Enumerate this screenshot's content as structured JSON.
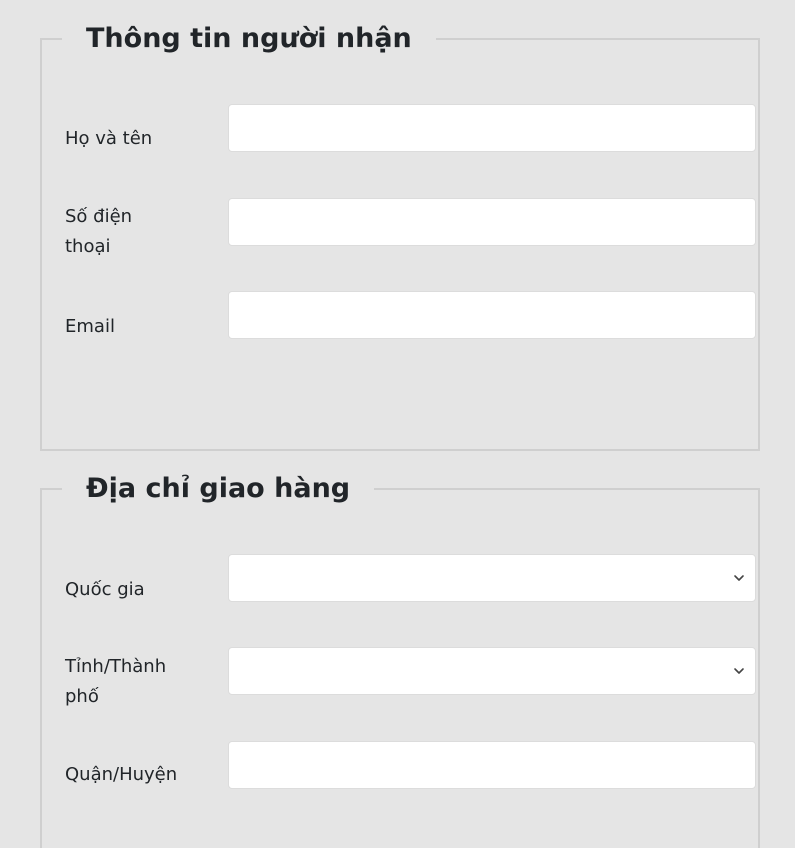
{
  "recipient": {
    "legend": "Thông tin người nhận",
    "fields": [
      {
        "label": "Họ và tên",
        "value": "",
        "placeholder": ""
      },
      {
        "label": "Số điện thoại",
        "value": "",
        "placeholder": ""
      },
      {
        "label": "Email",
        "value": "",
        "placeholder": ""
      }
    ]
  },
  "shipping": {
    "legend": "Địa chỉ giao hàng",
    "country": {
      "label": "Quốc gia",
      "selected": ""
    },
    "province": {
      "label": "Tỉnh/Thành phố",
      "selected": ""
    },
    "district": {
      "label": "Quận/Huyện",
      "value": "",
      "placeholder": ""
    }
  },
  "icons": {
    "select_chevron": "chevron-down-icon"
  },
  "colors": {
    "background": "#e5e5e5",
    "border": "#cfcfcf",
    "input_background": "#ffffff",
    "text": "#212529"
  }
}
